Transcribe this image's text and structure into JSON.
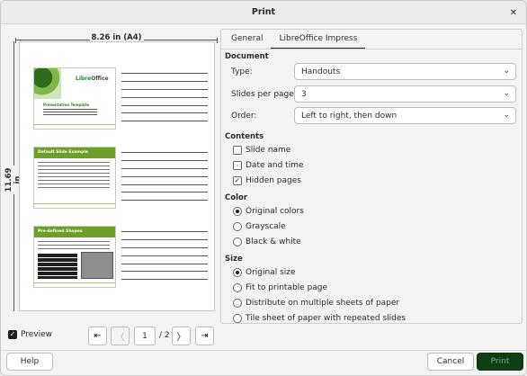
{
  "window": {
    "title": "Print"
  },
  "preview": {
    "width_label": "8.26 in (A4)",
    "height_label": "11.69 in",
    "slides": [
      {
        "logo_a": "Libre",
        "logo_b": "Office",
        "title": "Presentation Template"
      },
      {
        "title": "Default Slide Example"
      },
      {
        "title": "Pre-defined Shapes"
      }
    ],
    "preview_label": "Preview",
    "preview_checked": true,
    "page_current": "1",
    "page_total": "/ 2"
  },
  "tabs": [
    {
      "label": "General",
      "active": false
    },
    {
      "label": "LibreOffice Impress",
      "active": true
    }
  ],
  "document": {
    "heading": "Document",
    "type_label": "Type:",
    "type_value": "Handouts",
    "slides_per_page_label": "Slides per page:",
    "slides_per_page_value": "3",
    "order_label": "Order:",
    "order_value": "Left to right, then down"
  },
  "contents": {
    "heading": "Contents",
    "slide_name": "Slide name",
    "date_time": "Date and time",
    "hidden_pages": "Hidden pages"
  },
  "color": {
    "heading": "Color",
    "original": "Original colors",
    "grayscale": "Grayscale",
    "bw": "Black & white"
  },
  "size": {
    "heading": "Size",
    "original": "Original size",
    "fit": "Fit to printable page",
    "distribute": "Distribute on multiple sheets of paper",
    "tile": "Tile sheet of paper with repeated slides"
  },
  "buttons": {
    "help": "Help",
    "cancel": "Cancel",
    "print": "Print"
  },
  "colors": {
    "accent_green": "#5a8f2a",
    "print_button_bg": "#0d3f12"
  }
}
